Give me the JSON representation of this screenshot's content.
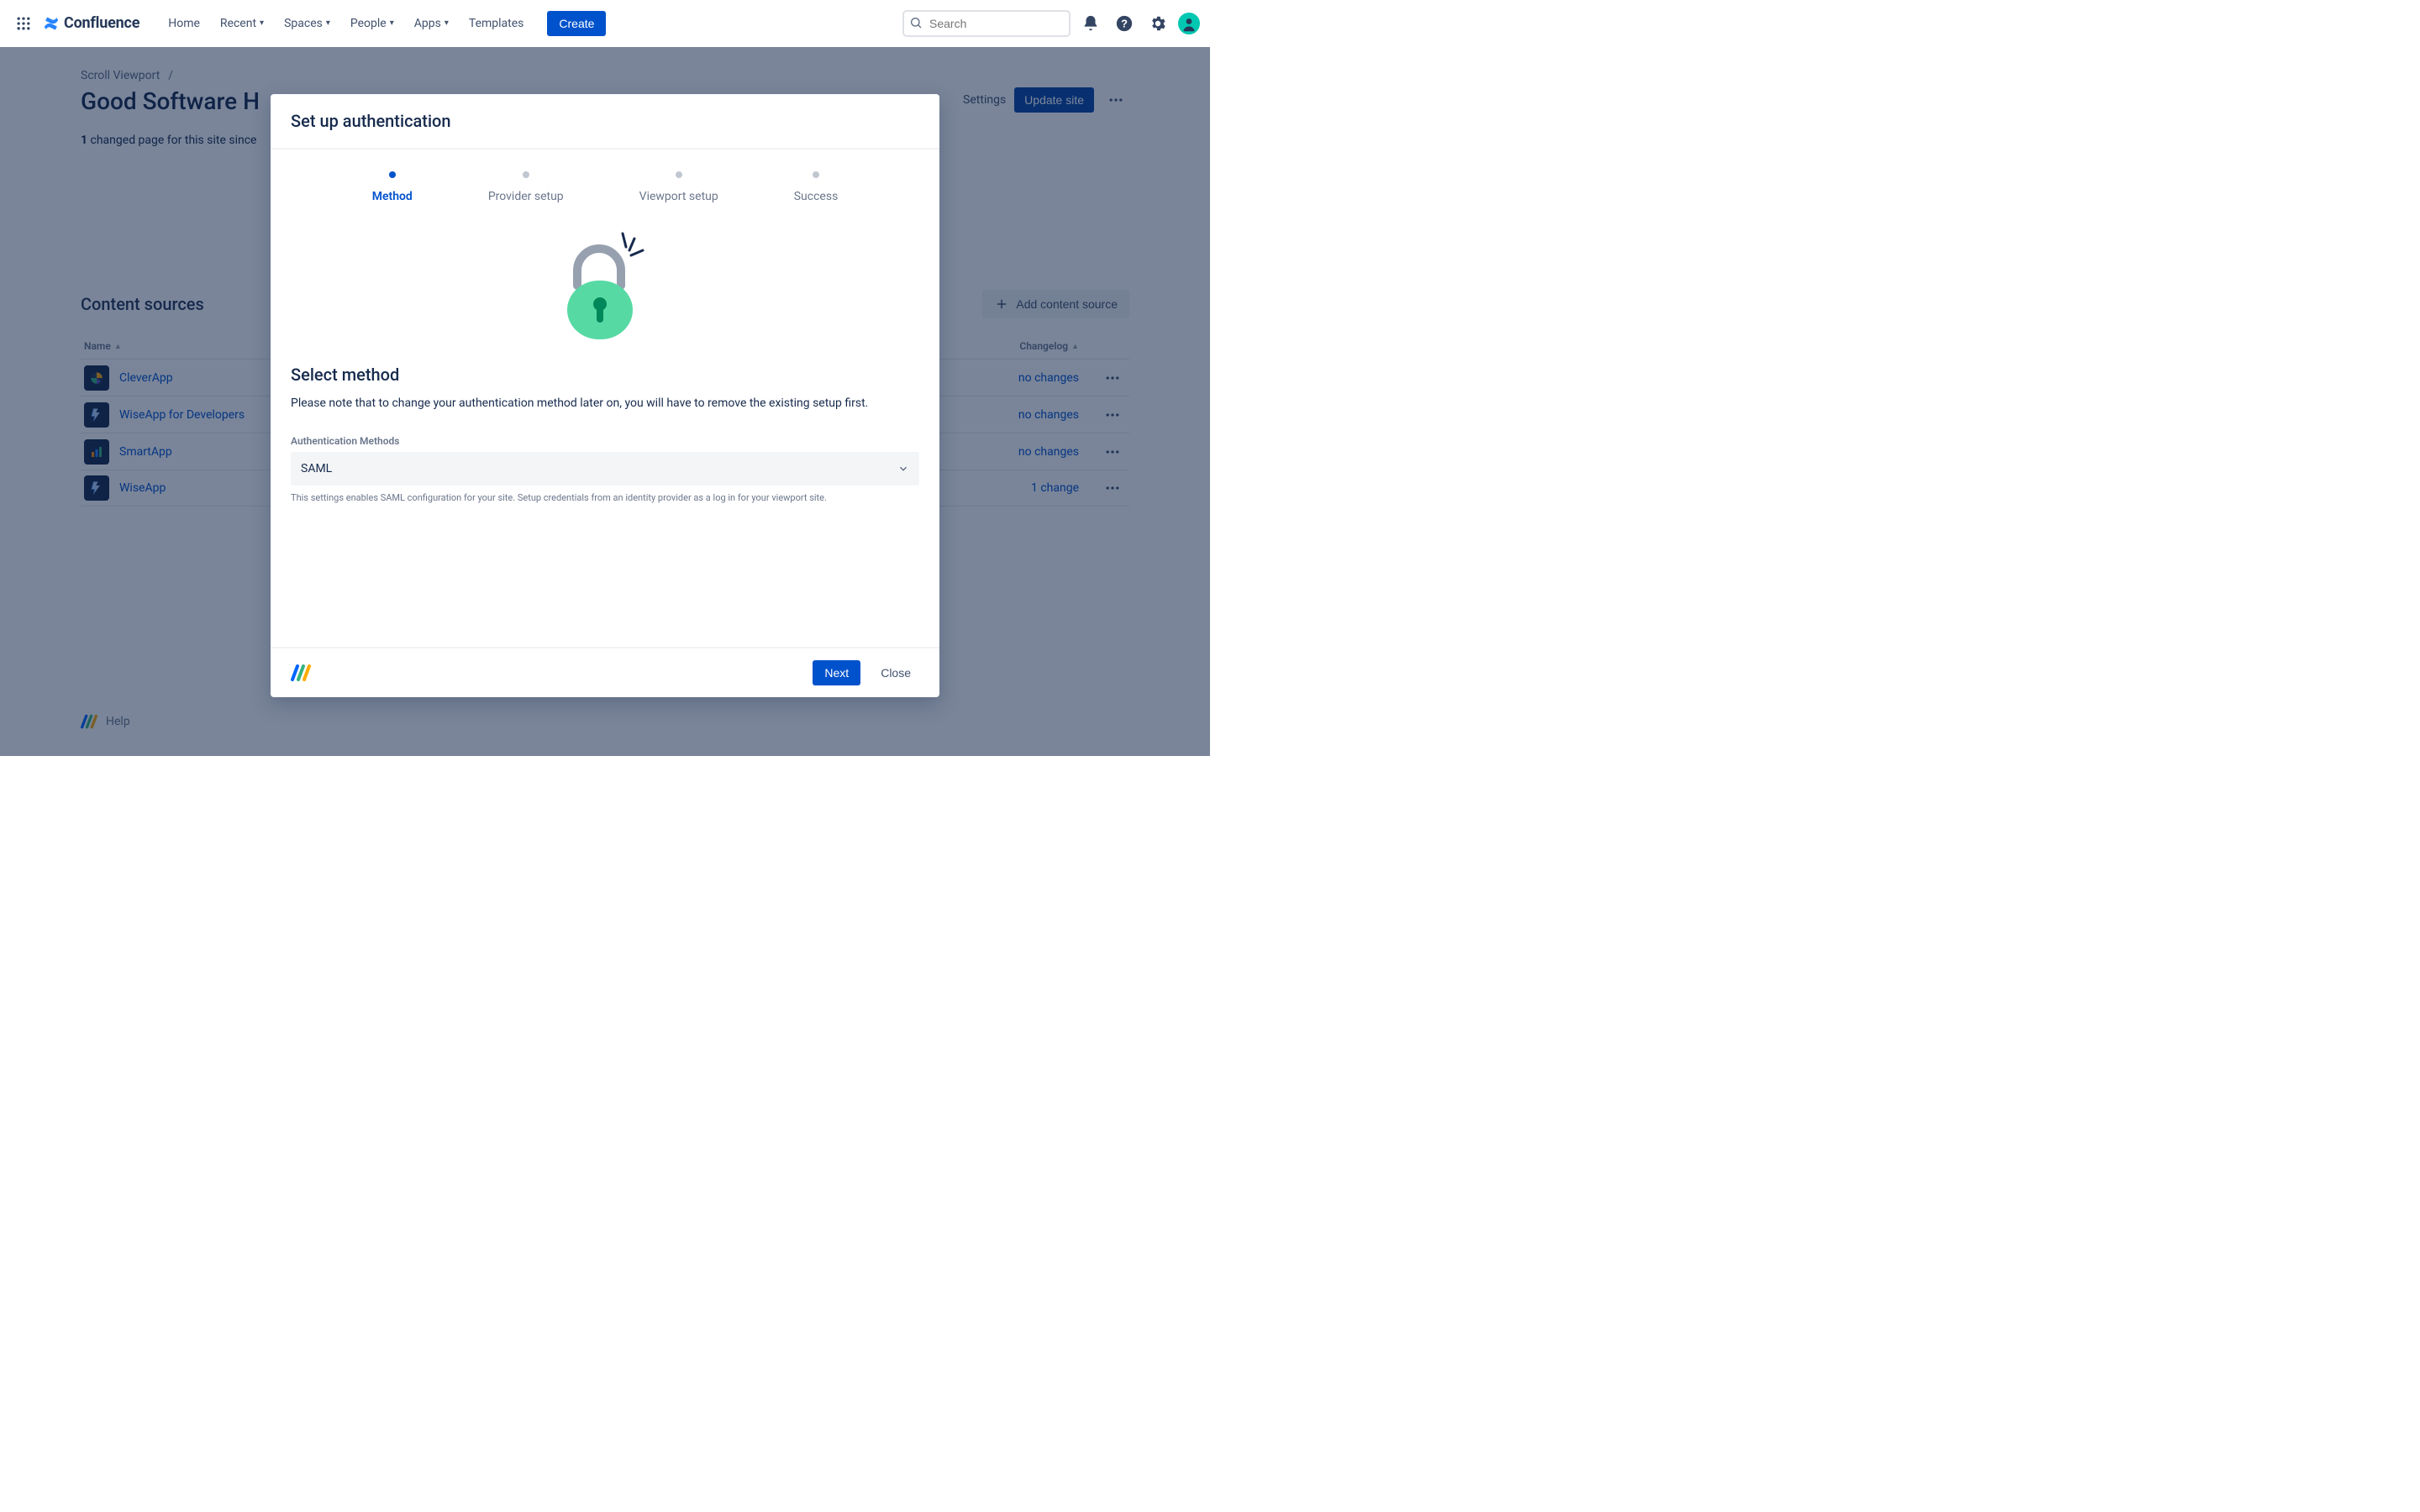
{
  "nav": {
    "product": "Confluence",
    "links": {
      "home": "Home",
      "recent": "Recent",
      "spaces": "Spaces",
      "people": "People",
      "apps": "Apps",
      "templates": "Templates"
    },
    "create": "Create",
    "search_placeholder": "Search"
  },
  "page": {
    "breadcrumb_root": "Scroll Viewport",
    "title_visible": "Good Software H",
    "settings": "Settings",
    "update_site": "Update site",
    "change_note_bold": "1",
    "change_note_rest": " changed page for this site since",
    "content_sources_heading": "Content sources",
    "add_source": "Add content source",
    "columns": {
      "name": "Name",
      "changelog": "Changelog"
    },
    "rows": [
      {
        "name": "CleverApp",
        "changelog": "no changes",
        "icon": "pie"
      },
      {
        "name": "WiseApp for Developers",
        "changelog": "no changes",
        "icon": "bolt"
      },
      {
        "name": "SmartApp",
        "changelog": "no changes",
        "icon": "bars"
      },
      {
        "name": "WiseApp",
        "changelog": "1 change",
        "icon": "bolt"
      }
    ],
    "help": "Help"
  },
  "modal": {
    "title": "Set up authentication",
    "steps": {
      "method": "Method",
      "provider": "Provider setup",
      "viewport": "Viewport setup",
      "success": "Success"
    },
    "section_heading": "Select method",
    "section_p": "Please note that to change your authentication method later on, you will have to remove the existing setup first.",
    "field_label": "Authentication Methods",
    "select_value": "SAML",
    "help_text": "This settings enables SAML configuration for your site. Setup credentials from an identity provider as a log in for your viewport site.",
    "next": "Next",
    "close": "Close"
  }
}
